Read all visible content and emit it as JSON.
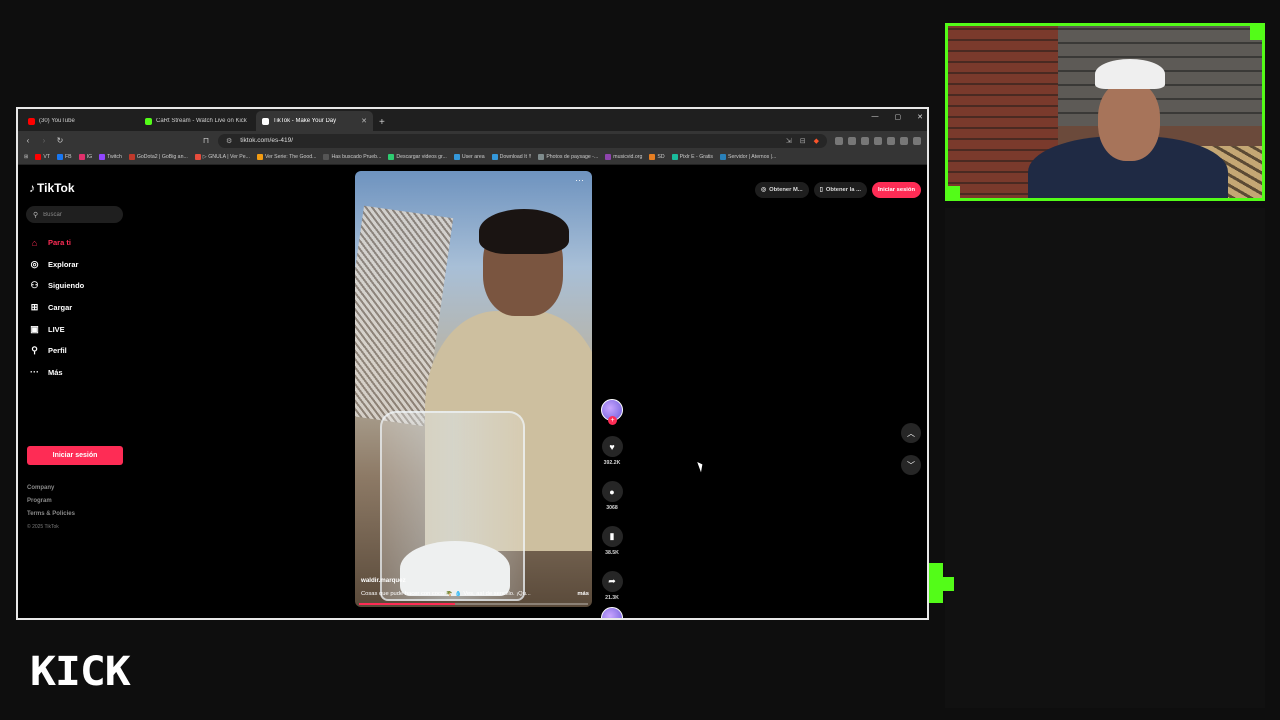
{
  "browser": {
    "tabs": [
      {
        "label": "(30) YouTube",
        "color": "#ff0000",
        "active": false
      },
      {
        "label": "CaRt Stream - Watch Live on Kick",
        "color": "#53fc18",
        "active": false
      },
      {
        "label": "TikTok - Make Your Day",
        "color": "#ffffff",
        "active": true
      }
    ],
    "new_tab": "+",
    "url": "tiktok.com/es-419/",
    "bookmarks": [
      {
        "label": "VT",
        "color": "#ff0000"
      },
      {
        "label": "FB",
        "color": "#1877f2"
      },
      {
        "label": "IG",
        "color": "#e1306c"
      },
      {
        "label": "Twitch",
        "color": "#9146ff"
      },
      {
        "label": "GoDota2 | GoBig an...",
        "color": "#c0392b"
      },
      {
        "label": "▷ GNULA | Ver Pe...",
        "color": "#e74c3c"
      },
      {
        "label": "Ver Serie: The Good...",
        "color": "#f39c12"
      },
      {
        "label": "Has buscado Prueb...",
        "color": "#555555"
      },
      {
        "label": "Descargar videos gr...",
        "color": "#2ecc71"
      },
      {
        "label": "User area",
        "color": "#3498db"
      },
      {
        "label": "Download It !!",
        "color": "#3498db"
      },
      {
        "label": "Photos de paysage -...",
        "color": "#7f8c8d"
      },
      {
        "label": "musicvid.org",
        "color": "#8e44ad"
      },
      {
        "label": "SD",
        "color": "#e67e22"
      },
      {
        "label": "Pixlr E - Gratis",
        "color": "#1abc9c"
      },
      {
        "label": "Servidor | Aternos |...",
        "color": "#2980b9"
      }
    ]
  },
  "tiktok": {
    "logo": "TikTok",
    "search_placeholder": "Buscar",
    "nav": [
      {
        "label": "Para ti",
        "icon": "home-icon",
        "glyph": "⌂",
        "active": true
      },
      {
        "label": "Explorar",
        "icon": "compass-icon",
        "glyph": "◎",
        "active": false
      },
      {
        "label": "Siguiendo",
        "icon": "following-icon",
        "glyph": "⚇",
        "active": false
      },
      {
        "label": "Cargar",
        "icon": "upload-icon",
        "glyph": "⊞",
        "active": false
      },
      {
        "label": "LIVE",
        "icon": "live-icon",
        "glyph": "▣",
        "active": false
      },
      {
        "label": "Perfil",
        "icon": "profile-icon",
        "glyph": "⚲",
        "active": false
      },
      {
        "label": "Más",
        "icon": "more-icon",
        "glyph": "···",
        "active": false
      }
    ],
    "login_button": "Iniciar sesión",
    "footer": {
      "company": "Company",
      "program": "Program",
      "terms": "Terms & Policies",
      "copyright": "© 2025 TikTok"
    },
    "top_actions": {
      "get_app": "Obtener M...",
      "get_desktop": "Obtener la ...",
      "login": "Iniciar sesión"
    },
    "video": {
      "username": "waldir.marquez",
      "caption": "Cosas que pude hacer con coco 🌴 💧 Ves, así de sencillo. ¡Qu...",
      "more": "más",
      "progress": 0.42
    },
    "actions": {
      "likes": "392.2K",
      "comments": "3068",
      "saves": "38.5K",
      "shares": "21.3K"
    }
  },
  "stream": {
    "platform_logo": "KICK",
    "accent": "#53fc18"
  }
}
